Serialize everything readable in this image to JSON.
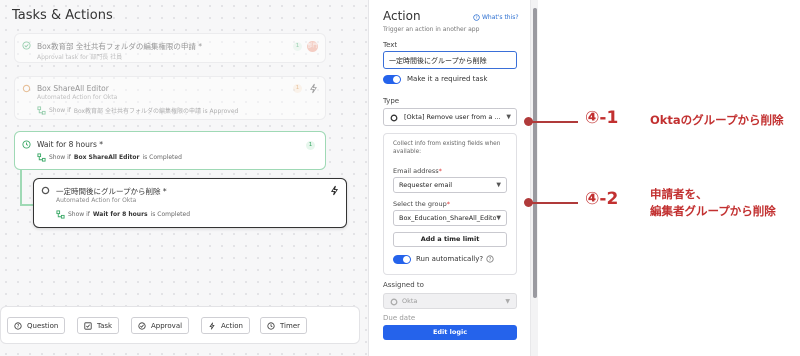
{
  "canvas": {
    "title": "Tasks & Actions",
    "cards": [
      {
        "title": "Box教育部 全社共有フォルダの編集権限の申請 *",
        "subtitle": "Approval task for 部門長 社員",
        "badge": "1",
        "avatar": "部門"
      },
      {
        "title": "Box ShareAll Editor",
        "subtitle": "Automated Action for Okta",
        "condition_prefix": "Show if",
        "condition_text": "Box教育部 全社共有フォルダの編集権限の申請 is Approved",
        "badge": "1"
      },
      {
        "title": "Wait for 8 hours *",
        "condition_prefix": "Show if",
        "condition_bold": "Box ShareAll Editor",
        "condition_suffix": "is Completed",
        "badge": "1"
      },
      {
        "title": "一定時間後にグループから削除 *",
        "subtitle": "Automated Action for Okta",
        "condition_prefix": "Show if",
        "condition_bold": "Wait for 8 hours",
        "condition_suffix": "is Completed"
      }
    ],
    "toolbar": [
      "Question",
      "Task",
      "Approval",
      "Action",
      "Timer"
    ]
  },
  "panel": {
    "title": "Action",
    "whats_this": "What's this?",
    "subtitle": "Trigger an action in another app",
    "text_label": "Text",
    "text_value": "一定時間後にグループから削除",
    "required_toggle_label": "Make it a required task",
    "type_label": "Type",
    "type_value": "[Okta] Remove user from a ...",
    "info": "Collect info from existing fields when available:",
    "email_label": "Email address",
    "email_value": "Requester email",
    "group_label": "Select the group",
    "group_value": "Box_Education_ShareAll_Editor",
    "time_limit_button": "Add a time limit",
    "run_auto_label": "Run automatically?",
    "assigned_label": "Assigned to",
    "assigned_value": "Okta",
    "due_label": "Due date",
    "edit_logic_button": "Edit logic",
    "required_mark": "*"
  },
  "annotations": [
    {
      "num": "④-1",
      "text": "Oktaのグループから削除"
    },
    {
      "num": "④-2",
      "line1": "申請者を、",
      "line2": "編集者グループから削除"
    }
  ],
  "colors": {
    "accent": "#2563eb",
    "annotation": "#c23030",
    "timer_green": "#3aa866"
  }
}
